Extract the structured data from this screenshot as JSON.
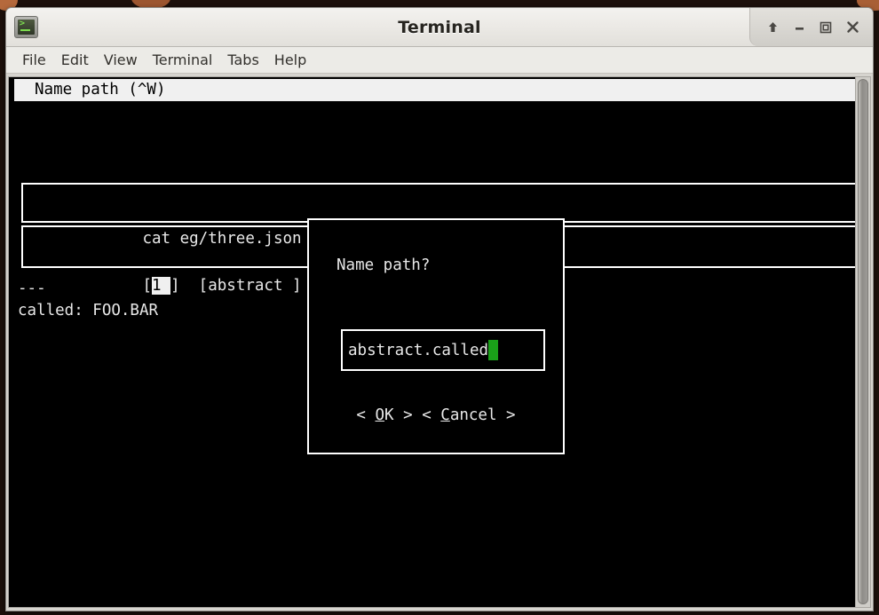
{
  "window": {
    "title": "Terminal",
    "icon": "terminal-icon",
    "controls": [
      {
        "name": "shade-button",
        "glyph": "↑"
      },
      {
        "name": "minimize-button",
        "glyph": "–"
      },
      {
        "name": "maximize-button",
        "glyph": "□"
      },
      {
        "name": "close-button",
        "glyph": "×"
      }
    ]
  },
  "menubar": {
    "items": [
      {
        "label": "File"
      },
      {
        "label": "Edit"
      },
      {
        "label": "View"
      },
      {
        "label": "Terminal"
      },
      {
        "label": "Tabs"
      },
      {
        "label": "Help"
      }
    ]
  },
  "tui": {
    "header": "Name path (^W)",
    "command_box": {
      "text": "cat eg/three.json"
    },
    "list_box": {
      "prefix": "[",
      "selected": "1 ",
      "suffix": "]  [abstract ]"
    },
    "output": "---\ncalled: FOO.BAR"
  },
  "dialog": {
    "label": "Name path?",
    "input": {
      "value": "abstract.called",
      "cursor_color": "#1aa019"
    },
    "buttons": [
      {
        "name": "ok-button",
        "left": "< ",
        "mnemonic": "O",
        "rest": "K >"
      },
      {
        "name": "cancel-button",
        "left": "< ",
        "mnemonic": "C",
        "rest": "ancel >"
      }
    ],
    "buttons_text": "< OK > < Cancel >"
  },
  "colors": {
    "terminal_bg": "#000000",
    "terminal_fg": "#e8e8e8",
    "cursor_green": "#1aa019",
    "titlebar": "#ecebe7"
  }
}
